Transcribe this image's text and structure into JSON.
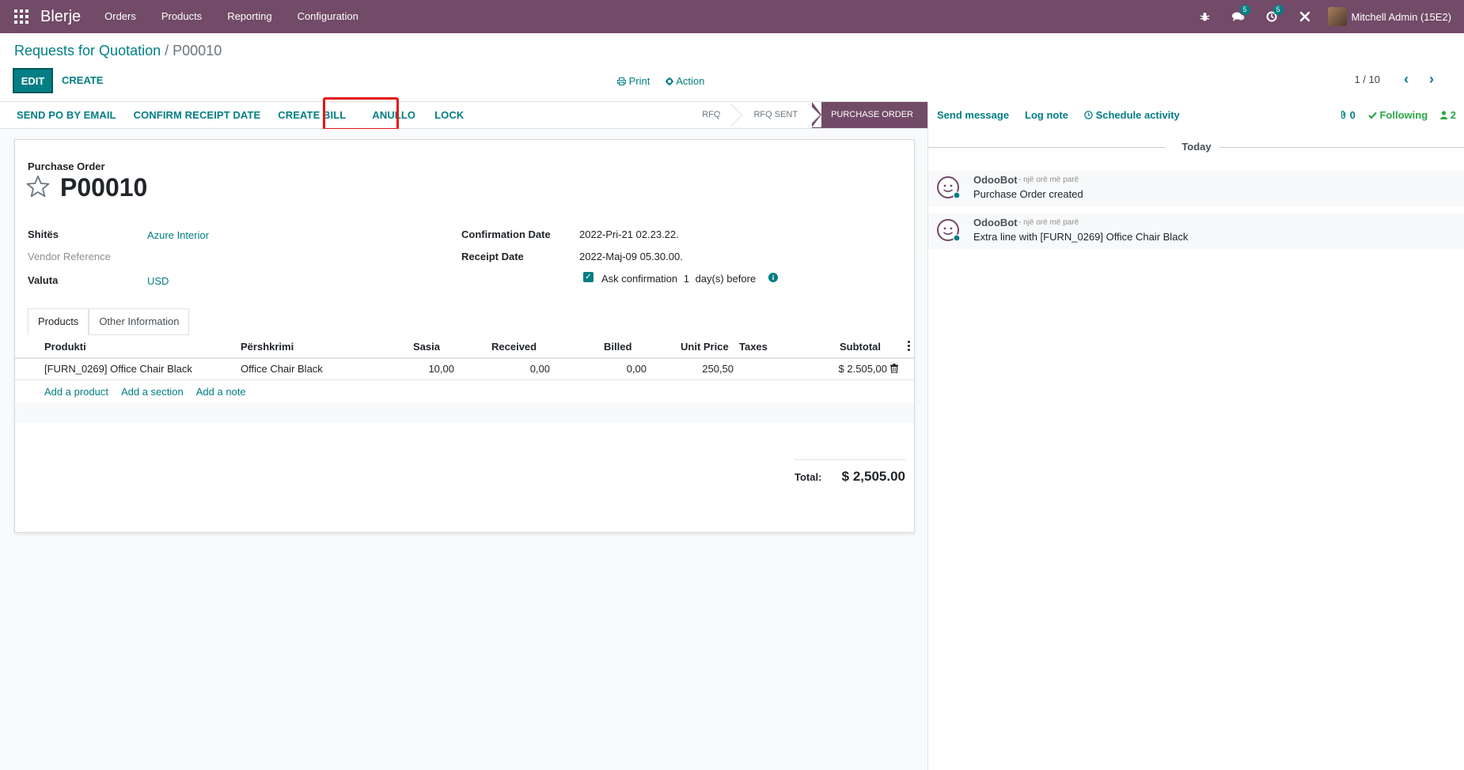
{
  "navbar": {
    "app_name": "Blerje",
    "menu": [
      "Orders",
      "Products",
      "Reporting",
      "Configuration"
    ],
    "messages_badge": "5",
    "activities_badge": "5",
    "user": "Mitchell Admin (15E2)"
  },
  "control_panel": {
    "breadcrumb_parent": "Requests for Quotation",
    "breadcrumb_sep": "/",
    "breadcrumb_current": "P00010",
    "edit_label": "EDIT",
    "create_label": "CREATE",
    "print_label": "Print",
    "action_label": "Action",
    "pager": "1 / 10"
  },
  "statusbar": {
    "buttons": [
      "SEND PO BY EMAIL",
      "CONFIRM RECEIPT DATE",
      "CREATE BILL",
      "ANULLO",
      "LOCK"
    ],
    "stages": [
      "RFQ",
      "RFQ SENT",
      "PURCHASE ORDER"
    ],
    "active_stage": "PURCHASE ORDER"
  },
  "form": {
    "doc_type": "Purchase Order",
    "doc_name": "P00010",
    "vendor_label": "Shitës",
    "vendor_value": "Azure Interior",
    "vendor_ref_label": "Vendor Reference",
    "currency_label": "Valuta",
    "currency_value": "USD",
    "confirmation_label": "Confirmation Date",
    "confirmation_value": "2022-Pri-21 02.23.22.",
    "receipt_label": "Receipt Date",
    "receipt_value": "2022-Maj-09 05.30.00.",
    "ask_confirmation_text": "Ask confirmation",
    "ask_confirmation_days": "1",
    "ask_confirmation_suffix": "day(s) before",
    "ask_confirmation_checked": true
  },
  "tabs": [
    "Products",
    "Other Information"
  ],
  "table": {
    "columns": [
      "Produkti",
      "Përshkrimi",
      "Sasia",
      "Received",
      "Billed",
      "Unit Price",
      "Taxes",
      "Subtotal"
    ],
    "rows": [
      {
        "product": "[FURN_0269] Office Chair Black",
        "description": "Office Chair Black",
        "qty": "10,00",
        "received": "0,00",
        "billed": "0,00",
        "unit_price": "250,50",
        "taxes": "",
        "subtotal": "$ 2.505,00"
      }
    ],
    "add_links": [
      "Add a product",
      "Add a section",
      "Add a note"
    ]
  },
  "totals": {
    "label": "Total:",
    "value": "$ 2,505.00"
  },
  "chatter": {
    "send_message": "Send message",
    "log_note": "Log note",
    "schedule_activity": "Schedule activity",
    "attachments": "0",
    "following": "Following",
    "followers": "2",
    "date_separator": "Today",
    "messages": [
      {
        "author": "OdooBot",
        "when": "- një orë më parë",
        "body": "Purchase Order created"
      },
      {
        "author": "OdooBot",
        "when": "- një orë më parë",
        "body": "Extra line with [FURN_0269] Office Chair Black"
      }
    ]
  },
  "colors": {
    "brand": "#714b67",
    "accent": "#017e84",
    "highlight": "#e51616",
    "following": "#28a745"
  }
}
